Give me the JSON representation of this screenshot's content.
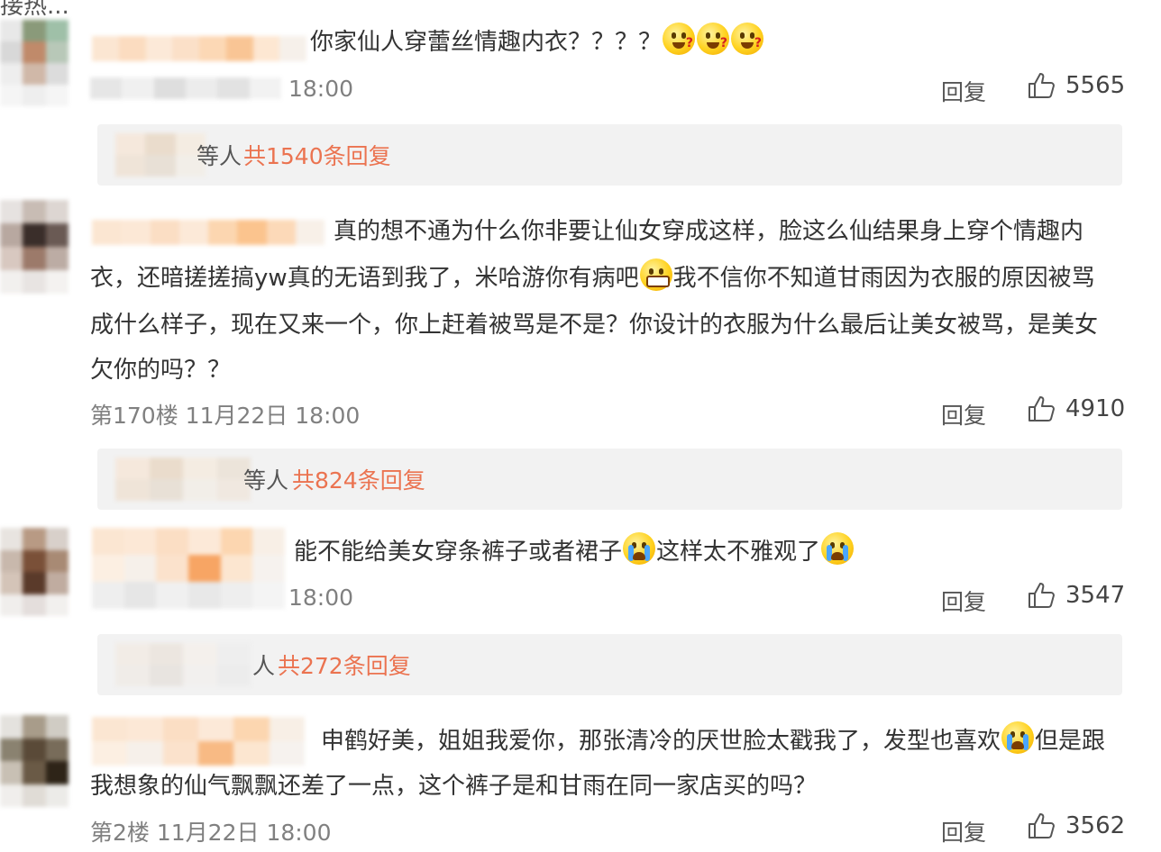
{
  "top_fragment": "接热...",
  "comments": [
    {
      "text_lines": [
        "你家仙人穿蕾丝情趣内衣？？？？"
      ],
      "emojis_trailing": [
        "question-face",
        "question-face",
        "question-face"
      ],
      "time": "18:00",
      "reply_label": "回复",
      "likes": "5565",
      "replies_author_tail": "等人",
      "replies_count": "共1540条回复"
    },
    {
      "text_lines": [
        "真的想不通为什么你非要让仙女穿成这样，脸这么仙结果身上穿个情趣内",
        "衣，还暗搓搓搞yw真的无语到我了，米哈游你有病吧",
        "我不信你不知道甘雨因为衣服的原因被骂",
        "成什么样子，现在又来一个，你上赶着被骂是不是？你设计的衣服为什么最后让美女被骂，是美女",
        "欠你的吗？？"
      ],
      "floor": "第170楼",
      "date": "11月22日",
      "time": "18:00",
      "reply_label": "回复",
      "likes": "4910",
      "replies_author_tail": "等人",
      "replies_count": "共824条回复"
    },
    {
      "text_lines": [
        "能不能给美女穿条裤子或者裙子",
        "这样太不雅观了"
      ],
      "time": "18:00",
      "reply_label": "回复",
      "likes": "3547",
      "replies_author_tail": "人",
      "replies_count": "共272条回复"
    },
    {
      "text_lines": [
        "申鹤好美，姐姐我爱你，那张清冷的厌世脸太戳我了，发型也喜欢",
        "但是跟",
        "我想象的仙气飘飘还差了一点，这个裤子是和甘雨在同一家店买的吗？"
      ],
      "floor": "第2楼",
      "date": "11月22日",
      "time": "18:00",
      "reply_label": "回复",
      "likes": "3562"
    }
  ],
  "colors": {
    "link_orange": "#eb7350",
    "meta_gray": "#808080",
    "reply_bar_bg": "#f2f2f2"
  }
}
